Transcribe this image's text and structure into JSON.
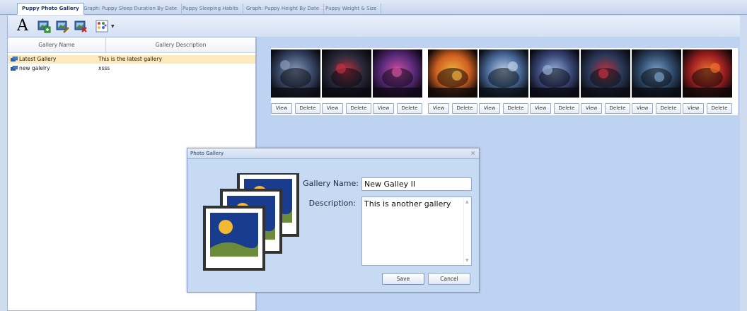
{
  "tabs": [
    {
      "label": "Puppy Photo Gallery",
      "active": true
    },
    {
      "label": "Graph: Puppy Sleep Duration By Date",
      "active": false
    },
    {
      "label": "Puppy Sleeping Habits",
      "active": false
    },
    {
      "label": "Graph: Puppy Height By Date",
      "active": false
    },
    {
      "label": "Puppy Weight & Size",
      "active": false
    }
  ],
  "toolbar": {
    "font_glyph": "A",
    "icons": [
      "add-image-icon",
      "edit-image-icon",
      "delete-image-icon",
      "color-palette-icon"
    ]
  },
  "gallery_list": {
    "columns": [
      "Gallery Name",
      "Gallery Description"
    ],
    "rows": [
      {
        "name": "Latest Gallery",
        "description": "This is the latest gallery",
        "selected": true
      },
      {
        "name": "new galelry",
        "description": "xsss",
        "selected": false
      }
    ]
  },
  "photos": {
    "view_label": "View",
    "delete_label": "Delete",
    "count": 9
  },
  "dialog": {
    "title": "Photo Gallery",
    "close_glyph": "×",
    "gallery_name_label": "Gallery Name:",
    "gallery_name_value": "New Galley II",
    "description_label": "Description:",
    "description_value": "This is another gallery",
    "save_label": "Save",
    "cancel_label": "Cancel"
  },
  "colors": {
    "accent": "#16356b",
    "selected_row": "#fde9bb",
    "panel_bg": "#bed2f2",
    "photo_sky": "#1a3c8f",
    "photo_sun": "#f2b935",
    "photo_hill": "#6b8b3a"
  }
}
